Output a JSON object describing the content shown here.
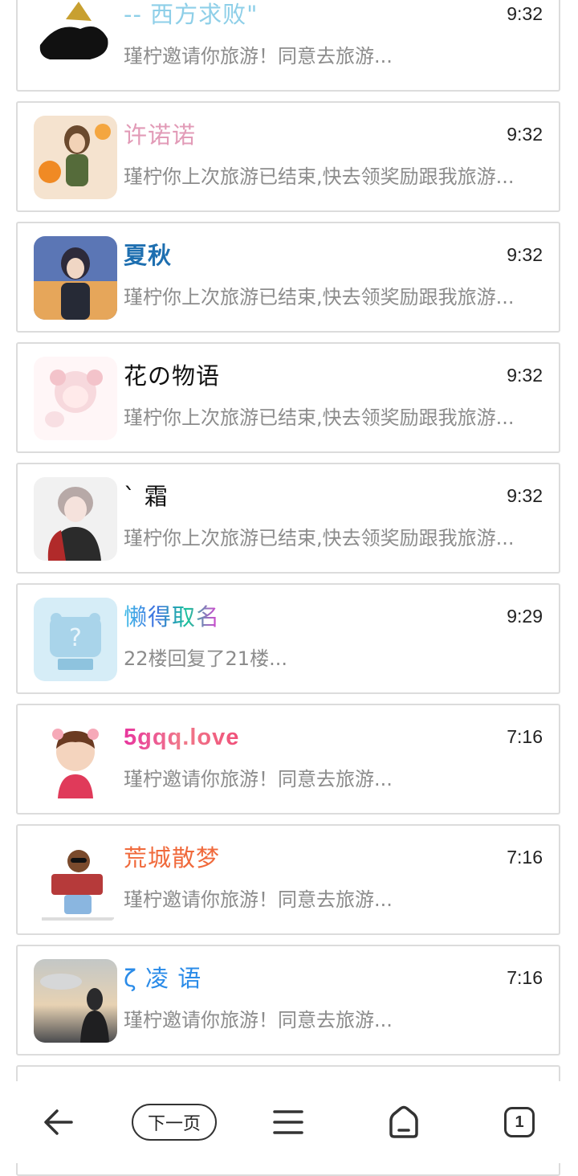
{
  "messages": [
    {
      "name": "-- 西方求败\"",
      "time": "9:32",
      "preview": "瑾柠邀请你旅游！同意去旅游...",
      "name_color": "#8ecfe8"
    },
    {
      "name": "许诺诺",
      "time": "9:32",
      "preview": "瑾柠你上次旅游已结束,快去领奖励跟我旅游...",
      "name_color": "#e29bb7"
    },
    {
      "name": "夏秋",
      "time": "9:32",
      "preview": "瑾柠你上次旅游已结束,快去领奖励跟我旅游...",
      "name_color": "#1e6fb0"
    },
    {
      "name": "花の物语",
      "time": "9:32",
      "preview": "瑾柠你上次旅游已结束,快去领奖励跟我旅游...",
      "name_color": "#111111"
    },
    {
      "name": "ˋ 霜",
      "time": "9:32",
      "preview": "瑾柠你上次旅游已结束,快去领奖励跟我旅游...",
      "name_color": "#111111"
    },
    {
      "name": "懒得取名",
      "time": "9:29",
      "preview": "22楼回复了21楼...",
      "name_color": "#8a5cf0"
    },
    {
      "name": "5gqq.love",
      "time": "7:16",
      "preview": "瑾柠邀请你旅游！同意去旅游...",
      "name_color": "#e0458e"
    },
    {
      "name": "荒城散梦",
      "time": "7:16",
      "preview": "瑾柠邀请你旅游！同意去旅游...",
      "name_color": "#f06a3c"
    },
    {
      "name": "ζ 凌 语",
      "time": "7:16",
      "preview": "瑾柠邀请你旅游！同意去旅游...",
      "name_color": "#2a8be8"
    }
  ],
  "bottom_nav": {
    "back_icon": "back-arrow-icon",
    "next_page_label": "下一页",
    "menu_icon": "menu-icon",
    "home_icon": "home-icon",
    "tabs_count": "1"
  }
}
